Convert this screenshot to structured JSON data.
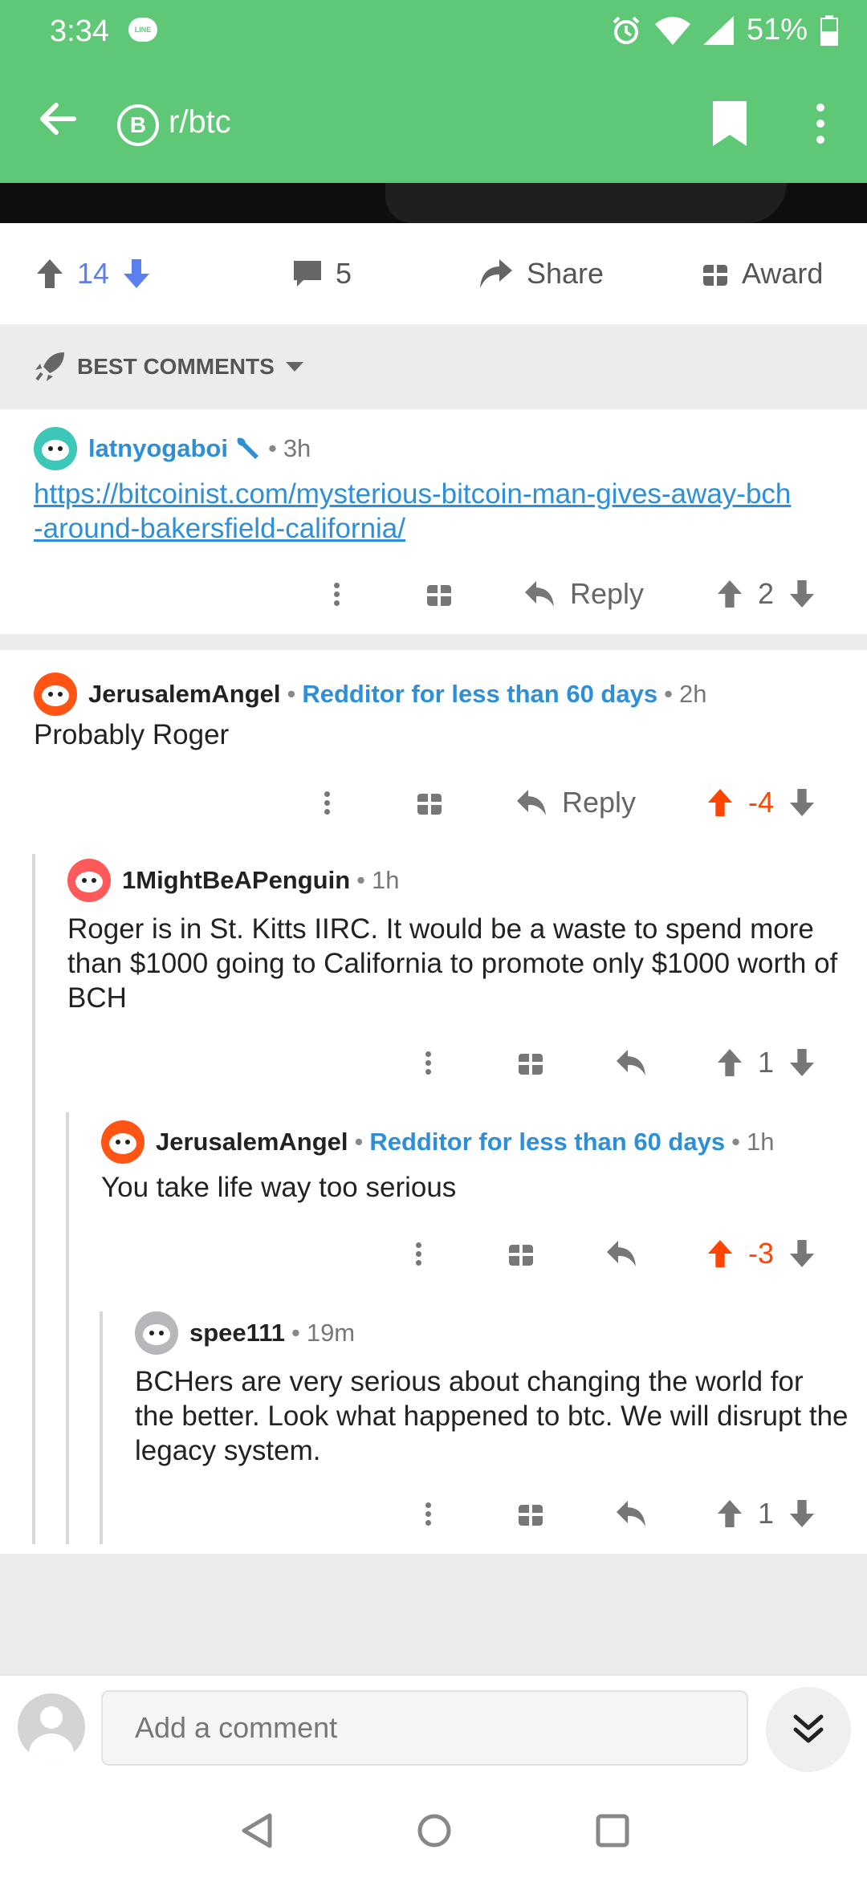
{
  "status": {
    "time": "3:34",
    "line_app": "LINE",
    "battery": "51%"
  },
  "header": {
    "subreddit": "r/btc",
    "subreddit_icon_letter": "B"
  },
  "actions": {
    "upvotes": "14",
    "comments": "5",
    "share": "Share",
    "award": "Award"
  },
  "sort": {
    "label": "BEST COMMENTS"
  },
  "comments": [
    {
      "author": "latnyogaboi",
      "time": "3h",
      "link": "https://bitcoinist.com/mysterious-bitcoin-man-gives-away-bch-around-bakersfield-california/",
      "link_line1": "https://bitcoinist.com/mysterious-bitcoin-man-gives-away-bch",
      "link_line2": "-around-bakersfield-california/",
      "reply": "Reply",
      "score": "2"
    },
    {
      "author": "JerusalemAngel",
      "flair": "Redditor for less than 60 days",
      "time": "2h",
      "body": "Probably Roger",
      "reply": "Reply",
      "score": "-4"
    },
    {
      "author": "1MightBeAPenguin",
      "time": "1h",
      "body": "Roger is in St. Kitts IIRC. It would be a waste to spend more than $1000 going to California to promote only $1000 worth of BCH",
      "score": "1"
    },
    {
      "author": "JerusalemAngel",
      "flair": "Redditor for less than 60 days",
      "time": "1h",
      "body": "You take life way too serious",
      "score": "-3"
    },
    {
      "author": "spee111",
      "time": "19m",
      "body": "BCHers are very serious about changing the world for the better. Look what happened to btc. We will disrupt the legacy system.",
      "score": "1"
    }
  ],
  "composer": {
    "placeholder": "Add a comment"
  },
  "colors": {
    "brand_green": "#5fc876",
    "upvote_blue": "#5b7ff0",
    "orangered": "#ff4500",
    "link_blue": "#2f8fd6"
  }
}
